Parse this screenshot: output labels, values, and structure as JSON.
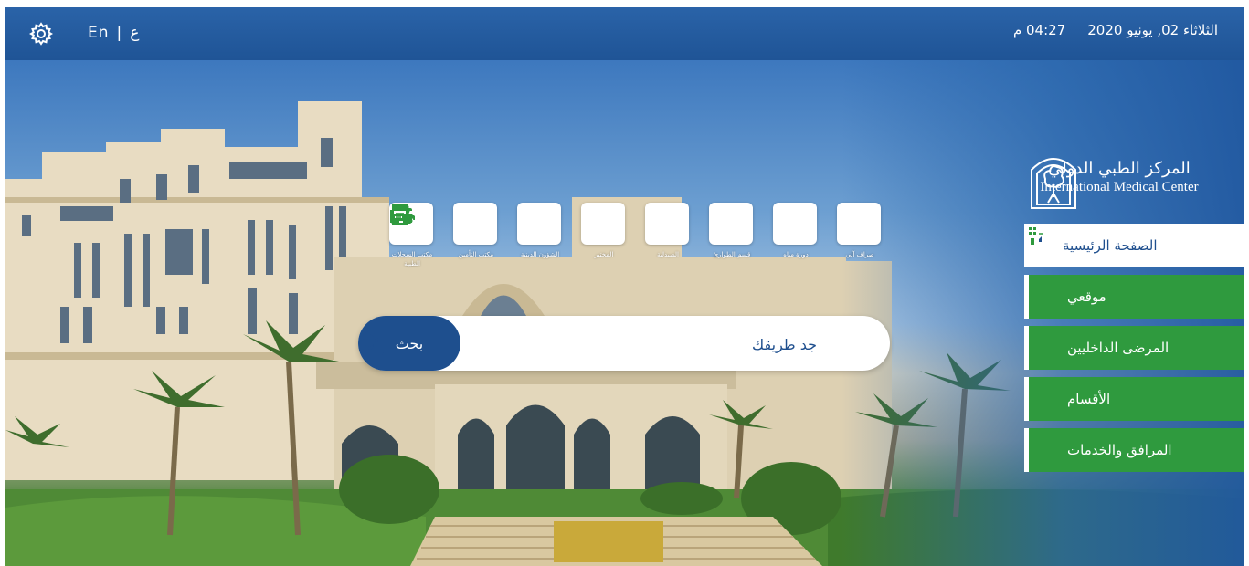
{
  "header": {
    "language": {
      "arabic": "ع",
      "separator": "|",
      "english": "En"
    },
    "date": "الثلاثاء 02, يونيو 2020",
    "time": "04:27 م"
  },
  "logo": {
    "name_ar": "المركز الطبي الدولي",
    "name_en": "International Medical Center"
  },
  "menu": {
    "items": [
      {
        "label": "الصفحة الرئيسية",
        "icon": "home-icon",
        "active": true
      },
      {
        "label": "موقعي",
        "icon": "location-pin-icon",
        "active": false
      },
      {
        "label": "المرضى الداخليين",
        "icon": "bed-icon",
        "active": false
      },
      {
        "label": "الأقسام",
        "icon": "heart-pulse-icon",
        "active": false
      },
      {
        "label": "المرافق والخدمات",
        "icon": "building-icon",
        "active": false
      }
    ]
  },
  "quick_links": [
    {
      "label": "صراف آلي",
      "icon": "atm-icon"
    },
    {
      "label": "دورة مياه",
      "icon": "restroom-icon"
    },
    {
      "label": "قسم الطوارئ",
      "icon": "ambulance-icon"
    },
    {
      "label": "الصيدلية",
      "icon": "pharmacy-icon"
    },
    {
      "label": "المختبر",
      "icon": "lab-flask-icon"
    },
    {
      "label": "الشؤون الدينية",
      "icon": "mosque-icon"
    },
    {
      "label": "مكتب التأمين",
      "icon": "insurance-card-icon"
    },
    {
      "label": "مكتب السجلات الطبية",
      "icon": "medical-records-icon"
    }
  ],
  "search": {
    "placeholder": "جد طريقك",
    "button_label": "بحث"
  },
  "colors": {
    "header_blue": "#1f5496",
    "menu_green": "#2f9a3e",
    "accent_navy": "#1e4f8e",
    "icon_green": "#2f9a3e"
  }
}
